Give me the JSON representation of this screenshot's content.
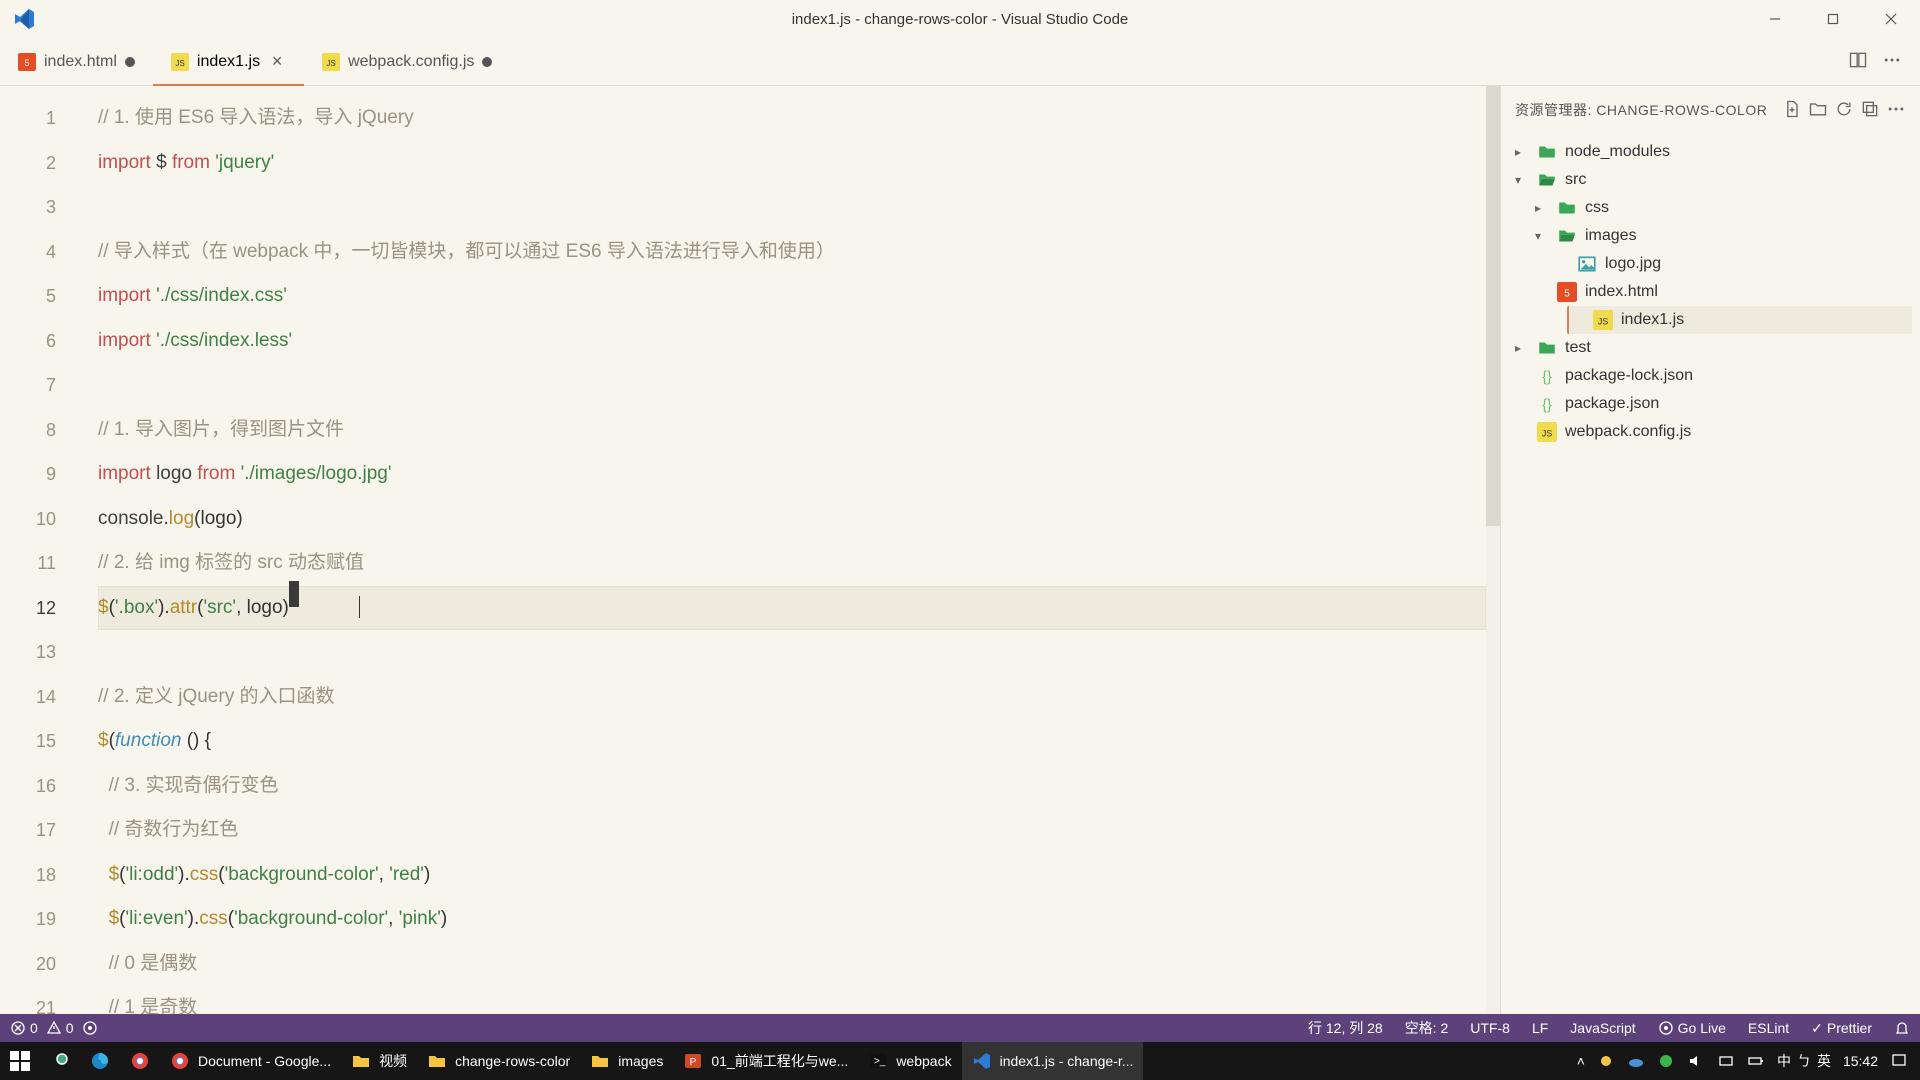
{
  "window": {
    "title": "index1.js - change-rows-color - Visual Studio Code"
  },
  "tabs": [
    {
      "label": "index.html",
      "icon": "html",
      "modified": true
    },
    {
      "label": "index1.js",
      "icon": "js",
      "active": true,
      "modified": false
    },
    {
      "label": "webpack.config.js",
      "icon": "js",
      "modified": true
    }
  ],
  "editor": {
    "activeLine": 12,
    "cursorCol": 28,
    "lines": [
      {
        "n": 1,
        "segs": [
          {
            "c": "c-cm",
            "t": "// 1. 使用 ES6 导入语法，导入 jQuery"
          }
        ]
      },
      {
        "n": 2,
        "segs": [
          {
            "c": "c-kw",
            "t": "import"
          },
          {
            "c": "",
            "t": " "
          },
          {
            "c": "c-va",
            "t": "$"
          },
          {
            "c": "",
            "t": " "
          },
          {
            "c": "c-kw",
            "t": "from"
          },
          {
            "c": "",
            "t": " "
          },
          {
            "c": "c-st",
            "t": "'jquery'"
          }
        ]
      },
      {
        "n": 3,
        "segs": []
      },
      {
        "n": 4,
        "segs": [
          {
            "c": "c-cm",
            "t": "// 导入样式（在 webpack 中，一切皆模块，都可以通过 ES6 导入语法进行导入和使用）"
          }
        ]
      },
      {
        "n": 5,
        "segs": [
          {
            "c": "c-kw",
            "t": "import"
          },
          {
            "c": "",
            "t": " "
          },
          {
            "c": "c-st",
            "t": "'./css/index.css'"
          }
        ]
      },
      {
        "n": 6,
        "segs": [
          {
            "c": "c-kw",
            "t": "import"
          },
          {
            "c": "",
            "t": " "
          },
          {
            "c": "c-st",
            "t": "'./css/index.less'"
          }
        ]
      },
      {
        "n": 7,
        "segs": []
      },
      {
        "n": 8,
        "segs": [
          {
            "c": "c-cm",
            "t": "// 1. 导入图片，得到图片文件"
          }
        ]
      },
      {
        "n": 9,
        "segs": [
          {
            "c": "c-kw",
            "t": "import"
          },
          {
            "c": "",
            "t": " "
          },
          {
            "c": "c-va",
            "t": "logo"
          },
          {
            "c": "",
            "t": " "
          },
          {
            "c": "c-kw",
            "t": "from"
          },
          {
            "c": "",
            "t": " "
          },
          {
            "c": "c-st",
            "t": "'./images/logo.jpg'"
          }
        ]
      },
      {
        "n": 10,
        "segs": [
          {
            "c": "c-va",
            "t": "console"
          },
          {
            "c": "",
            "t": "."
          },
          {
            "c": "c-fn",
            "t": "log"
          },
          {
            "c": "",
            "t": "(logo)"
          }
        ]
      },
      {
        "n": 11,
        "segs": [
          {
            "c": "c-cm",
            "t": "// 2. 给 img 标签的 src 动态赋值"
          }
        ]
      },
      {
        "n": 12,
        "segs": [
          {
            "c": "c-usg",
            "t": "$"
          },
          {
            "c": "",
            "t": "("
          },
          {
            "c": "c-st",
            "t": "'.box'"
          },
          {
            "c": "",
            "t": ")."
          },
          {
            "c": "c-fn",
            "t": "attr"
          },
          {
            "c": "",
            "t": "("
          },
          {
            "c": "c-st",
            "t": "'src'"
          },
          {
            "c": "",
            "t": ", logo)"
          }
        ],
        "cursorAfter": true
      },
      {
        "n": 13,
        "segs": []
      },
      {
        "n": 14,
        "segs": [
          {
            "c": "c-cm",
            "t": "// 2. 定义 jQuery 的入口函数"
          }
        ]
      },
      {
        "n": 15,
        "segs": [
          {
            "c": "c-usg",
            "t": "$"
          },
          {
            "c": "",
            "t": "("
          },
          {
            "c": "c-bl",
            "t": "function"
          },
          {
            "c": "",
            "t": " () {"
          }
        ]
      },
      {
        "n": 16,
        "segs": [
          {
            "c": "",
            "t": "  "
          },
          {
            "c": "c-cm",
            "t": "// 3. 实现奇偶行变色"
          }
        ]
      },
      {
        "n": 17,
        "segs": [
          {
            "c": "",
            "t": "  "
          },
          {
            "c": "c-cm",
            "t": "// 奇数行为红色"
          }
        ]
      },
      {
        "n": 18,
        "segs": [
          {
            "c": "",
            "t": "  "
          },
          {
            "c": "c-usg",
            "t": "$"
          },
          {
            "c": "",
            "t": "("
          },
          {
            "c": "c-st",
            "t": "'li:odd'"
          },
          {
            "c": "",
            "t": ")."
          },
          {
            "c": "c-fn",
            "t": "css"
          },
          {
            "c": "",
            "t": "("
          },
          {
            "c": "c-st",
            "t": "'background-color'"
          },
          {
            "c": "",
            "t": ", "
          },
          {
            "c": "c-st",
            "t": "'red'"
          },
          {
            "c": "",
            "t": ")"
          }
        ]
      },
      {
        "n": 19,
        "segs": [
          {
            "c": "",
            "t": "  "
          },
          {
            "c": "c-usg",
            "t": "$"
          },
          {
            "c": "",
            "t": "("
          },
          {
            "c": "c-st",
            "t": "'li:even'"
          },
          {
            "c": "",
            "t": ")."
          },
          {
            "c": "c-fn",
            "t": "css"
          },
          {
            "c": "",
            "t": "("
          },
          {
            "c": "c-st",
            "t": "'background-color'"
          },
          {
            "c": "",
            "t": ", "
          },
          {
            "c": "c-st",
            "t": "'pink'"
          },
          {
            "c": "",
            "t": ")"
          }
        ]
      },
      {
        "n": 20,
        "segs": [
          {
            "c": "",
            "t": "  "
          },
          {
            "c": "c-cm",
            "t": "// 0 是偶数"
          }
        ]
      },
      {
        "n": 21,
        "segs": [
          {
            "c": "",
            "t": "  "
          },
          {
            "c": "c-cm",
            "t": "// 1 是奇数"
          }
        ]
      }
    ]
  },
  "explorer": {
    "title": "资源管理器: CHANGE-ROWS-COLOR",
    "tree": [
      {
        "label": "node_modules",
        "icon": "folder",
        "chev": "▸",
        "indent": 0
      },
      {
        "label": "src",
        "icon": "folder-open",
        "chev": "▾",
        "indent": 0
      },
      {
        "label": "css",
        "icon": "folder",
        "chev": "▸",
        "indent": 1
      },
      {
        "label": "images",
        "icon": "folder-open",
        "chev": "▾",
        "indent": 1
      },
      {
        "label": "logo.jpg",
        "icon": "image",
        "indent": 2
      },
      {
        "label": "index.html",
        "icon": "html",
        "indent": 1
      },
      {
        "label": "index1.js",
        "icon": "js",
        "indent": 1,
        "selected": true
      },
      {
        "label": "test",
        "icon": "folder",
        "chev": "▸",
        "indent": 0
      },
      {
        "label": "package-lock.json",
        "icon": "json",
        "indent": 0
      },
      {
        "label": "package.json",
        "icon": "json",
        "indent": 0
      },
      {
        "label": "webpack.config.js",
        "icon": "js",
        "indent": 0
      }
    ]
  },
  "statusbar": {
    "errors": "0",
    "warnings": "0",
    "line_col": "行 12, 列 28",
    "spaces": "空格: 2",
    "encoding": "UTF-8",
    "eol": "LF",
    "lang": "JavaScript",
    "golive": "Go Live",
    "eslint": "ESLint",
    "prettier": "Prettier"
  },
  "taskbar": {
    "items": [
      {
        "label": "",
        "icon": "win"
      },
      {
        "label": "",
        "icon": "search"
      },
      {
        "label": "",
        "icon": "edge"
      },
      {
        "label": "",
        "icon": "chrome"
      },
      {
        "label": "Document - Google...",
        "icon": "chrome"
      },
      {
        "label": "视频",
        "icon": "folder"
      },
      {
        "label": "change-rows-color",
        "icon": "folder"
      },
      {
        "label": "images",
        "icon": "folder"
      },
      {
        "label": "01_前端工程化与we...",
        "icon": "ppt"
      },
      {
        "label": "webpack",
        "icon": "cmd"
      },
      {
        "label": "index1.js - change-r...",
        "icon": "vscode",
        "active": true
      }
    ],
    "clock_top": "15:42",
    "ime_left": "中",
    "ime_mid": "ㄅ",
    "ime_right": "英"
  },
  "icons": {
    "html_color": "#e44d26",
    "js_color": "#f0db4f",
    "folder_color": "#3aa757",
    "json_color": "#6fbf73",
    "image_color": "#3aa0a7"
  }
}
